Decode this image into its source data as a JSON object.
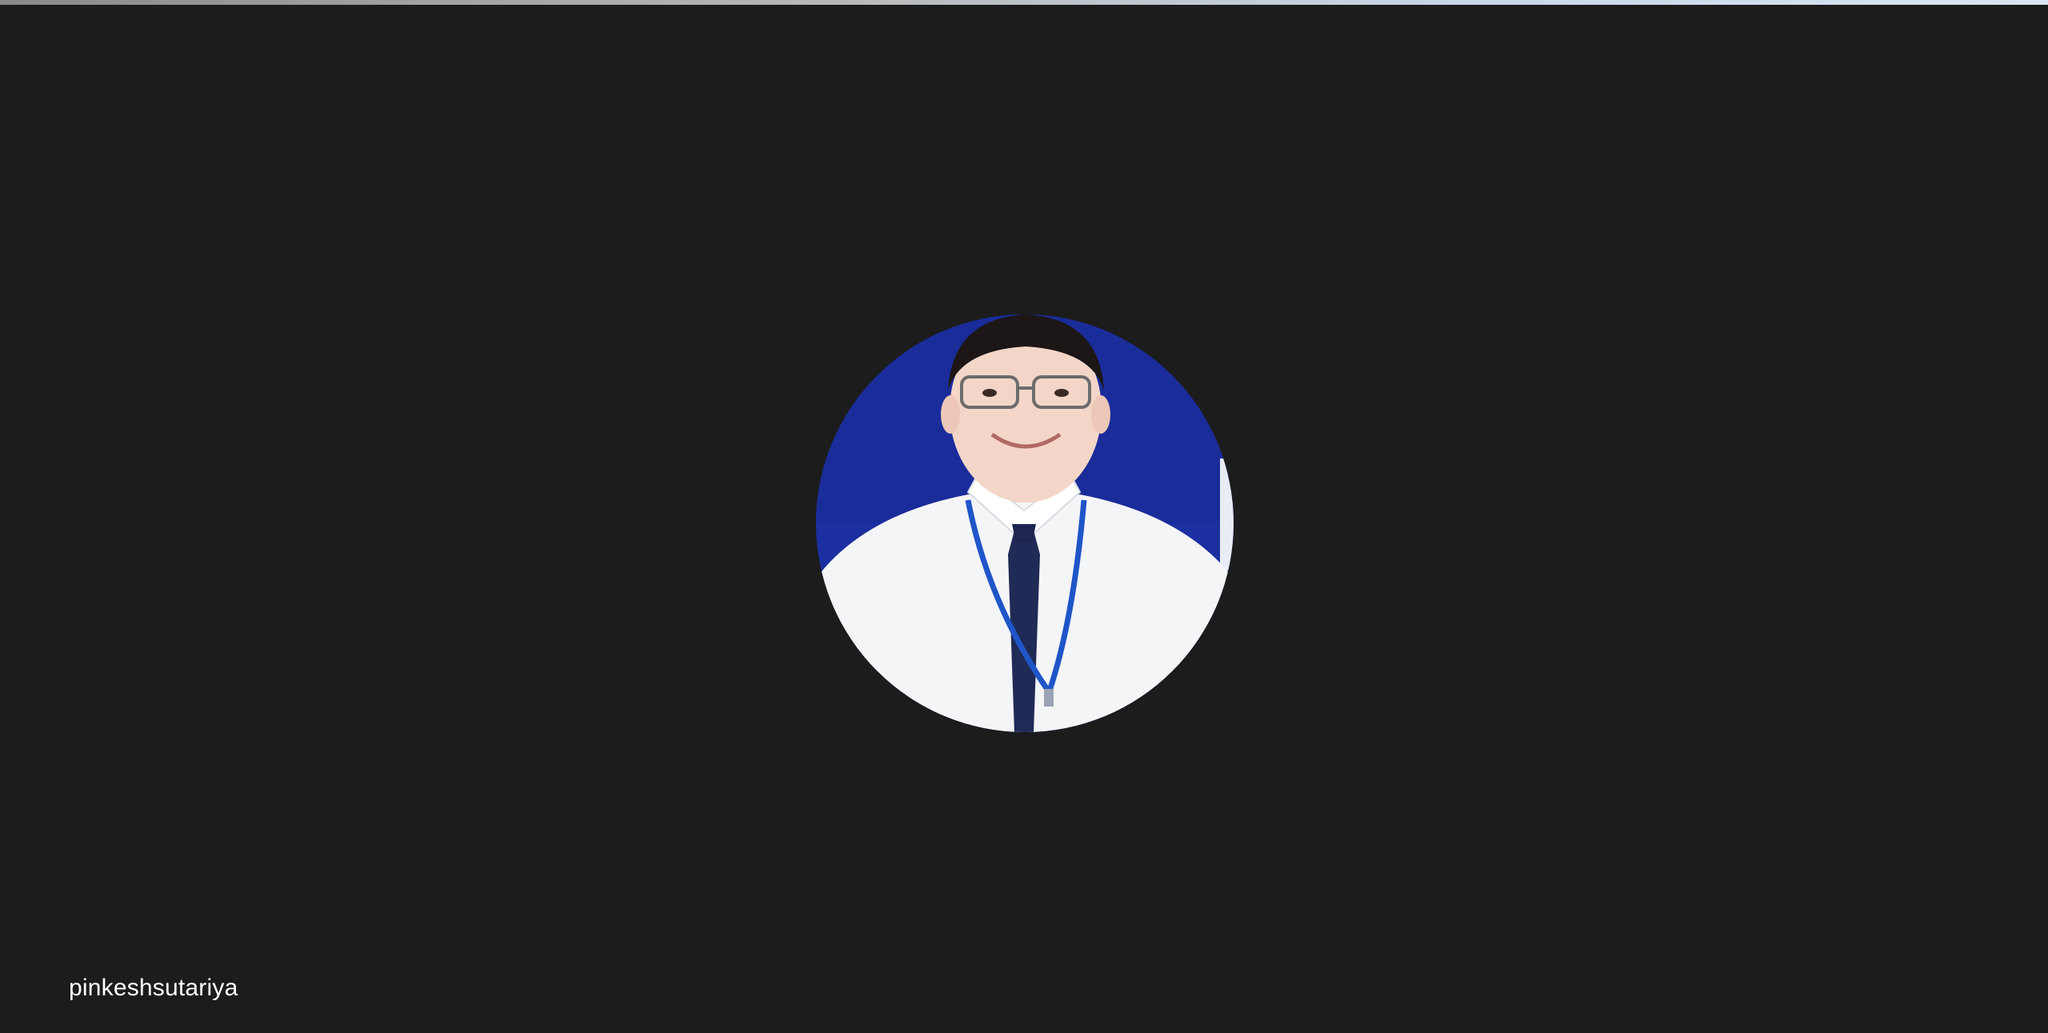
{
  "participant": {
    "name": "pinkeshsutariya",
    "avatar_icon": "participant-photo"
  },
  "colors": {
    "background": "#1c1c1c",
    "avatar_backdrop": "#1a2f9e",
    "name_text": "#ffffff"
  }
}
